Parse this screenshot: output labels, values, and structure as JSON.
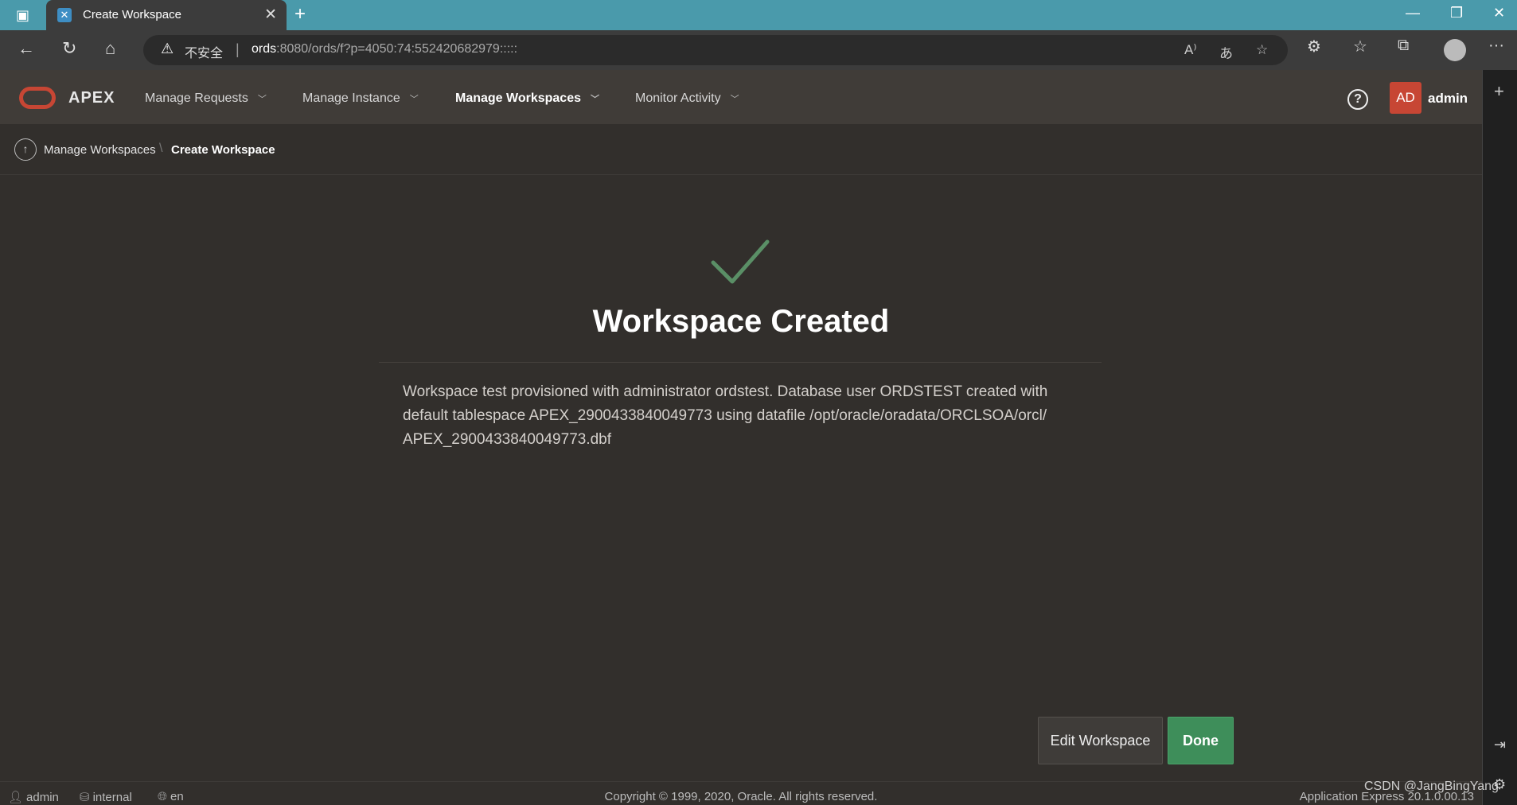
{
  "browser": {
    "tab_title": "Create Workspace",
    "insecure_label": "不安全",
    "url_host": "ords",
    "url_path": ":8080/ords/f?p=4050:74:552420682979:::::"
  },
  "header": {
    "logo_text": "APEX",
    "menus": [
      {
        "label": "Manage Requests"
      },
      {
        "label": "Manage Instance"
      },
      {
        "label": "Manage Workspaces"
      },
      {
        "label": "Monitor Activity"
      }
    ],
    "avatar_initials": "AD",
    "username": "admin"
  },
  "breadcrumb": {
    "parent": "Manage Workspaces",
    "current": "Create Workspace"
  },
  "main": {
    "title": "Workspace Created",
    "message": "Workspace test provisioned with administrator ordstest. Database user ORDSTEST created with default tablespace APEX_2900433840049773 using datafile /opt/oracle/oradata/ORCLSOA/orcl/ APEX_2900433840049773.dbf",
    "edit_button": "Edit Workspace",
    "done_button": "Done"
  },
  "footer": {
    "user": "admin",
    "schema": "internal",
    "language": "en",
    "copyright": "Copyright © 1999, 2020, Oracle. All rights reserved.",
    "version": "Application Express 20.1.0.00.13"
  },
  "watermark": "CSDN @JangBingYang",
  "colors": {
    "accent": "#c74634",
    "success": "#3e8e5a",
    "background": "#322f2c"
  }
}
